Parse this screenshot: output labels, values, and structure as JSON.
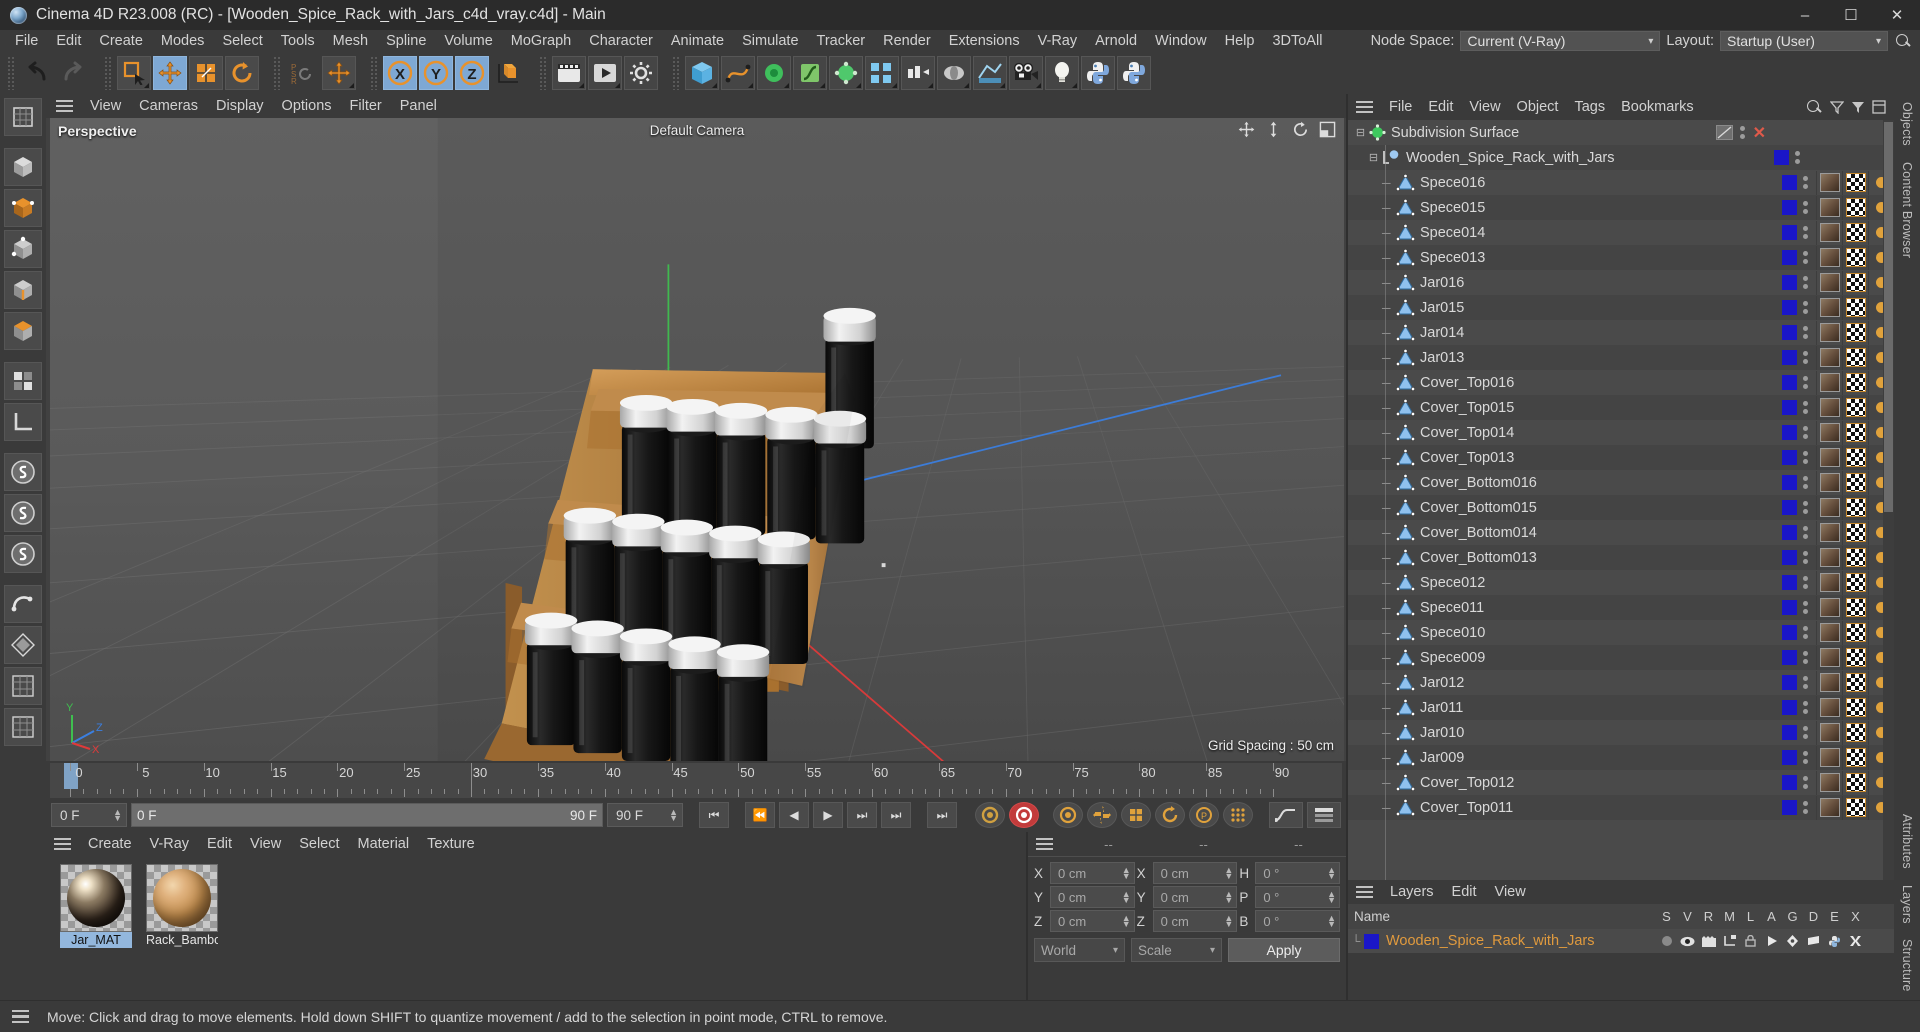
{
  "window": {
    "title": "Cinema 4D R23.008 (RC) - [Wooden_Spice_Rack_with_Jars_c4d_vray.c4d] - Main",
    "minimize": "–",
    "maximize": "☐",
    "close": "✕"
  },
  "menubar": {
    "items": [
      "File",
      "Edit",
      "Create",
      "Modes",
      "Select",
      "Tools",
      "Mesh",
      "Spline",
      "Volume",
      "MoGraph",
      "Character",
      "Animate",
      "Simulate",
      "Tracker",
      "Render",
      "Extensions",
      "V-Ray",
      "Arnold",
      "Window",
      "Help",
      "3DToAll"
    ],
    "node_space_label": "Node Space:",
    "node_space_value": "Current (V-Ray)",
    "layout_label": "Layout:",
    "layout_value": "Startup (User)",
    "search_icon": "search-icon"
  },
  "viewport": {
    "menu": [
      "View",
      "Cameras",
      "Display",
      "Options",
      "Filter",
      "Panel"
    ],
    "label": "Perspective",
    "camera": "Default Camera",
    "grid_spacing": "Grid Spacing : 50 cm",
    "axis_x": "X",
    "axis_y": "Y",
    "axis_z": "Z"
  },
  "timeline": {
    "ticks": [
      0,
      5,
      10,
      15,
      20,
      25,
      30,
      35,
      40,
      45,
      50,
      55,
      60,
      65,
      70,
      75,
      80,
      85,
      90
    ],
    "current_frame": "0 F",
    "range_start": "0 F",
    "range_end": "90 F",
    "max_frame": "90 F"
  },
  "materials": {
    "menu": [
      "Create",
      "V-Ray",
      "Edit",
      "View",
      "Select",
      "Material",
      "Texture"
    ],
    "items": [
      {
        "name": "Jar_MAT",
        "selected": true
      },
      {
        "name": "Rack_Bamboo",
        "selected": false
      }
    ]
  },
  "coordinates": {
    "headers": [
      "--",
      "--",
      "--"
    ],
    "rows": [
      {
        "a1": "X",
        "v1": "0 cm",
        "a2": "X",
        "v2": "0 cm",
        "a3": "H",
        "v3": "0 °"
      },
      {
        "a1": "Y",
        "v1": "0 cm",
        "a2": "Y",
        "v2": "0 cm",
        "a3": "P",
        "v3": "0 °"
      },
      {
        "a1": "Z",
        "v1": "0 cm",
        "a2": "Z",
        "v2": "0 cm",
        "a3": "B",
        "v3": "0 °"
      }
    ],
    "world_dropdown": "World",
    "scale_dropdown": "Scale",
    "apply_button": "Apply"
  },
  "object_manager": {
    "menu": [
      "File",
      "Edit",
      "View",
      "Object",
      "Tags",
      "Bookmarks"
    ],
    "root": {
      "name": "Subdivision Surface",
      "icon": "subdivision-surface-icon"
    },
    "group": {
      "name": "Wooden_Spice_Rack_with_Jars",
      "icon": "null-object-icon"
    },
    "objects": [
      "Spece016",
      "Spece015",
      "Spece014",
      "Spece013",
      "Jar016",
      "Jar015",
      "Jar014",
      "Jar013",
      "Cover_Top016",
      "Cover_Top015",
      "Cover_Top014",
      "Cover_Top013",
      "Cover_Bottom016",
      "Cover_Bottom015",
      "Cover_Bottom014",
      "Cover_Bottom013",
      "Spece012",
      "Spece011",
      "Spece010",
      "Spece009",
      "Jar012",
      "Jar011",
      "Jar010",
      "Jar009",
      "Cover_Top012",
      "Cover_Top011"
    ]
  },
  "layers": {
    "menu": [
      "Layers",
      "Edit",
      "View"
    ],
    "name_header": "Name",
    "columns": [
      "S",
      "V",
      "R",
      "M",
      "L",
      "A",
      "G",
      "D",
      "E",
      "X"
    ],
    "rows": [
      {
        "name": "Wooden_Spice_Rack_with_Jars",
        "color": "#1a16c8"
      }
    ]
  },
  "right_tabs": [
    "Objects",
    "Content Browser",
    "Attributes",
    "Layers",
    "Structure"
  ],
  "status": {
    "message": "Move: Click and drag to move elements. Hold down SHIFT to quantize movement / add to the selection in point mode, CTRL to remove."
  }
}
